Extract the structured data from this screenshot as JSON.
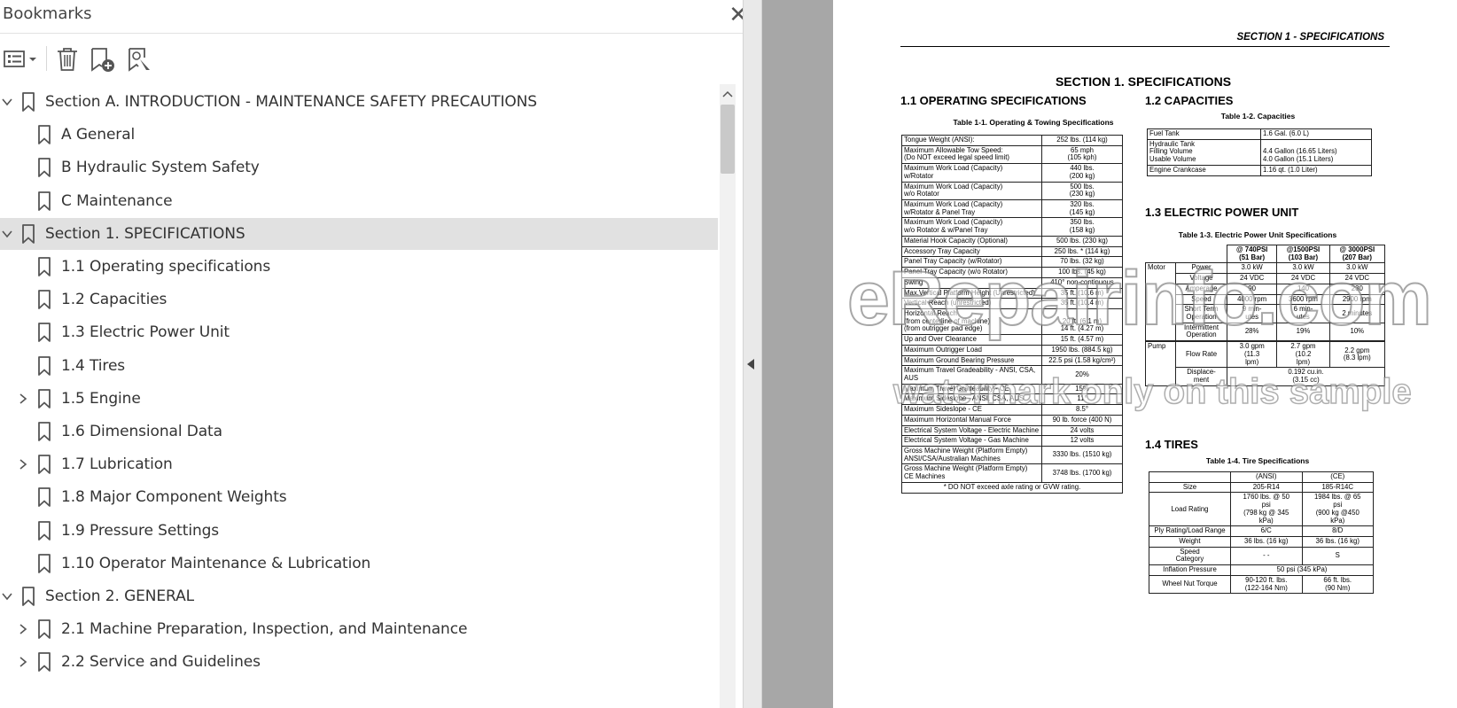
{
  "panel": {
    "title": "Bookmarks",
    "close_glyph": "✕",
    "toolbar": [
      "options-menu-icon",
      "delete-bookmark-icon",
      "add-bookmark-icon",
      "find-bookmark-icon"
    ]
  },
  "bookmarks": [
    {
      "label": "Section A. INTRODUCTION - MAINTENANCE SAFETY PRECAUTIONS",
      "level": 0,
      "expander": "open"
    },
    {
      "label": "A General",
      "level": 1,
      "expander": "none"
    },
    {
      "label": "B Hydraulic System Safety",
      "level": 1,
      "expander": "none"
    },
    {
      "label": "C Maintenance",
      "level": 1,
      "expander": "none"
    },
    {
      "label": "Section 1. SPECIFICATIONS",
      "level": 0,
      "expander": "open",
      "selected": true
    },
    {
      "label": "1.1 Operating specifications",
      "level": 1,
      "expander": "none"
    },
    {
      "label": "1.2 Capacities",
      "level": 1,
      "expander": "none"
    },
    {
      "label": "1.3 Electric Power Unit",
      "level": 1,
      "expander": "none"
    },
    {
      "label": "1.4 Tires",
      "level": 1,
      "expander": "none"
    },
    {
      "label": "1.5 Engine",
      "level": 1,
      "expander": "closed"
    },
    {
      "label": "1.6 Dimensional Data",
      "level": 1,
      "expander": "none"
    },
    {
      "label": "1.7 Lubrication",
      "level": 1,
      "expander": "closed"
    },
    {
      "label": "1.8 Major Component Weights",
      "level": 1,
      "expander": "none"
    },
    {
      "label": "1.9 Pressure Settings",
      "level": 1,
      "expander": "none"
    },
    {
      "label": "1.10 Operator Maintenance & Lubrication",
      "level": 1,
      "expander": "none"
    },
    {
      "label": "Section 2. GENERAL",
      "level": 0,
      "expander": "open"
    },
    {
      "label": "2.1 Machine Preparation, Inspection, and Maintenance",
      "level": 1,
      "expander": "closed"
    },
    {
      "label": "2.2 Service and Guidelines",
      "level": 1,
      "expander": "closed"
    }
  ],
  "document": {
    "running_header": "SECTION 1 - SPECIFICATIONS",
    "section_title": "SECTION 1.  SPECIFICATIONS",
    "h_1_1": "1.1    OPERATING SPECIFICATIONS",
    "cap_1_1": "Table 1-1.   Operating & Towing Specifications",
    "t11": [
      [
        "Tongue Weight (ANSI):",
        "252 lbs. (114 kg)"
      ],
      [
        "Maximum Allowable Tow Speed:\n(Do NOT exceed legal speed limit)",
        "65 mph\n(105 kph)"
      ],
      [
        "Maximum Work Load (Capacity)\n      w/Rotator",
        "440 lbs.\n(200 kg)"
      ],
      [
        "Maximum Work Load (Capacity)\n      w/o Rotator",
        "500 lbs.\n(230 kg)"
      ],
      [
        "Maximum Work Load (Capacity)\n      w/Rotator & Panel Tray",
        "320 lbs.\n(145 kg)"
      ],
      [
        "Maximum Work Load (Capacity)\n      w/o Rotator & w/Panel Tray",
        "350 lbs.\n(158 kg)"
      ],
      [
        "Material Hook Capacity (Optional)",
        "500 lbs. (230 kg)"
      ],
      [
        "Accessory Tray Capacity",
        "250 lbs. * (114 kg)"
      ],
      [
        "Panel Tray Capacity (w/Rotator)",
        "70 lbs. (32 kg)"
      ],
      [
        "Panel Tray Capacity (w/o Rotator)",
        "100 lbs. (45 kg)"
      ],
      [
        "Swing",
        "410° non-continuous"
      ],
      [
        "Max.Vertical Platform Height (Unrestricted)",
        "35 ft. (10.6 m)"
      ],
      [
        "Vertical Reach (unrestricted)",
        "35 ft. (10.4 m)"
      ],
      [
        "Horizontal Reach\n   (from centerline of machine)\n   (from outrigger pad edge)",
        "\n20 ft. (6.1 m)\n14 ft. (4.27 m)"
      ],
      [
        "Up and Over Clearance",
        "15 ft. (4.57 m)"
      ],
      [
        "Maximum Outrigger Load",
        "1950 lbs. (884.5 kg)"
      ],
      [
        "Maximum Ground Bearing Pressure",
        "22.5 psi (1.58 kg/cm²)"
      ],
      [
        "Maximum Travel Gradeability - ANSI, CSA,\nAUS",
        "20%"
      ],
      [
        "Maximum Travel Gradeability - CE",
        "15%"
      ],
      [
        "Maximum Sideslope - ANSI, CSA, AUS",
        "11°"
      ],
      [
        "Maximum Sideslope - CE",
        "8.5°"
      ],
      [
        "Maximum Horizontal Manual Force",
        "90 lb. force (400 N)"
      ],
      [
        "Electrical System Voltage - Electric Machine",
        "24 volts"
      ],
      [
        "Electrical System Voltage - Gas Machine",
        "12 volts"
      ],
      [
        "Gross Machine Weight (Platform Empty)\n    ANSI/CSA/Australian Machines",
        "3330 lbs. (1510 kg)"
      ],
      [
        "Gross Machine Weight (Platform Empty)\n    CE Machines",
        "3748 lbs. (1700 kg)"
      ]
    ],
    "t11_footnote": "* DO NOT exceed axle rating or GVW rating.",
    "h_1_2": "1.2    CAPACITIES",
    "cap_1_2": "Table 1-2.  Capacities",
    "t12": [
      [
        "Fuel Tank",
        "1.6 Gal. (6.0 L)"
      ],
      [
        "Hydraulic Tank\n   Filling Volume\n   Usable Volume",
        "\n4.4 Gallon (16.65 Liters)\n4.0 Gallon (15.1 Liters)"
      ],
      [
        "Engine Crankcase",
        "1.16 qt. (1.0 Liter)"
      ]
    ],
    "h_1_3": "1.3    ELECTRIC POWER UNIT",
    "cap_1_3": "Table 1-3.  Electric Power Unit Specifications",
    "t13_head": [
      "@ 740PSI\n(51 Bar)",
      "@1500PSI\n(103 Bar)",
      "@ 3000PSI\n(207 Bar)"
    ],
    "t13_motor": "Motor",
    "t13_pump": "Pump",
    "t13_rows": [
      [
        "Power",
        "3.0 kW",
        "3.0 kW",
        "3.0 kW"
      ],
      [
        "Voltage",
        "24 VDC",
        "24 VDC",
        "24 VDC"
      ],
      [
        "Amperage",
        "90",
        "140",
        "230"
      ],
      [
        "Speed",
        "4000 rpm",
        "3600 rpm",
        "2900 rpm"
      ],
      [
        "Short Term\nOperation",
        "9 min-\nutes",
        "6 min-\nutes",
        "2 minutes"
      ],
      [
        "Intermittent\nOperation",
        "28%",
        "19%",
        "10%"
      ]
    ],
    "t13_flow": [
      "Flow Rate",
      "3.0 gpm\n(11.3\nlpm)",
      "2.7 gpm\n(10.2\nlpm)",
      "2.2 gpm\n(8.3 lpm)"
    ],
    "t13_disp": [
      "Displace-\nment",
      "0.192 cu.in.\n(3.15 cc)"
    ],
    "h_1_4": "1.4    TIRES",
    "cap_1_4": "Table 1-4.  Tire Specifications",
    "t14_head": [
      "(ANSI)",
      "(CE)"
    ],
    "t14": [
      [
        "Size",
        "205-R14",
        "185-R14C"
      ],
      [
        "Load Rating",
        "1760 lbs. @ 50\npsi\n(798 kg @ 345\nkPa)",
        "1984 lbs. @ 65\npsi\n(900 kg @450\nkPa)"
      ],
      [
        "Ply Rating/Load Range",
        "6/C",
        "8/D"
      ],
      [
        "Weight",
        "36 lbs. (16 kg)",
        "36 lbs. (16 kg)"
      ],
      [
        "Speed\nCategory",
        "- -",
        "S"
      ]
    ],
    "t14_inflation": [
      "Inflation Pressure",
      "50 psi (345 kPa)"
    ],
    "t14_torque": [
      "Wheel Nut Torque",
      "90-120 ft. lbs.\n(122-164 Nm)",
      "66 ft. lbs.\n(90 Nm)"
    ]
  },
  "watermark": {
    "line1": "eRepairinfo.com",
    "line2": "watermark only on this sample"
  }
}
